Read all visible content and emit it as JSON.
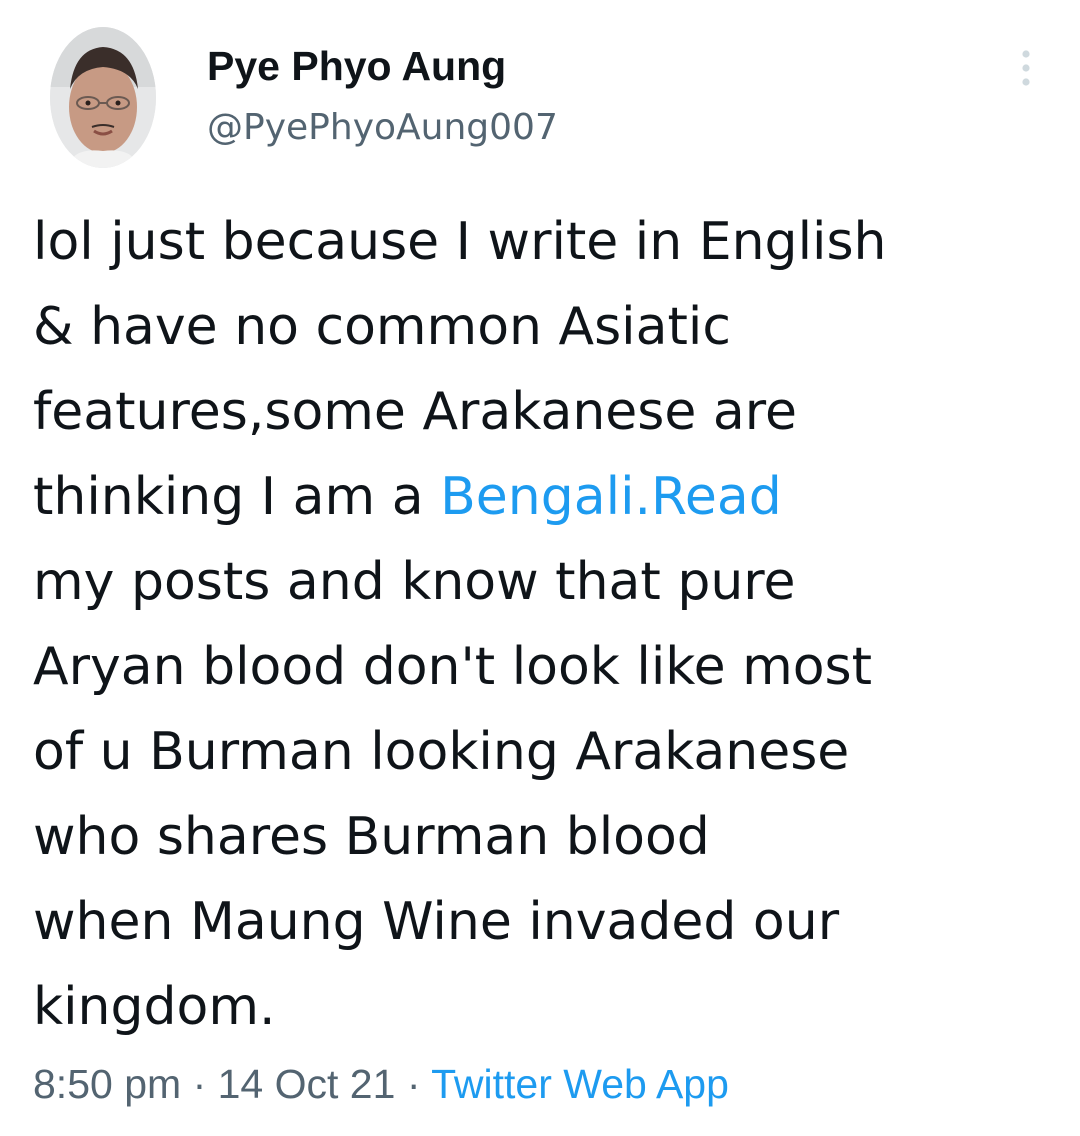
{
  "author": {
    "display_name": "Pye Phyo Aung",
    "handle": "@PyePhyoAung007"
  },
  "tweet": {
    "lines": [
      {
        "text": "lol just because I write in English"
      },
      {
        "text": "& have no common Asiatic"
      },
      {
        "text": "features,some Arakanese are"
      },
      {
        "text": "thinking I am a ",
        "link": "Bengali.Read"
      },
      {
        "text": "my posts and know that pure"
      },
      {
        "text": "Aryan blood don't look like most"
      },
      {
        "text": "of u Burman looking Arakanese"
      },
      {
        "text": "who shares Burman blood"
      },
      {
        "text": "when Maung Wine invaded our"
      },
      {
        "text": "kingdom."
      }
    ]
  },
  "meta": {
    "time": "8:50 pm",
    "separator": "·",
    "date": "14 Oct 21",
    "source": "Twitter Web App"
  },
  "colors": {
    "text": "#0f1419",
    "secondary": "#536471",
    "link": "#1d9bf0",
    "more_dots": "#cfd9de"
  },
  "icons": {
    "more": "vertical-ellipsis-icon"
  }
}
